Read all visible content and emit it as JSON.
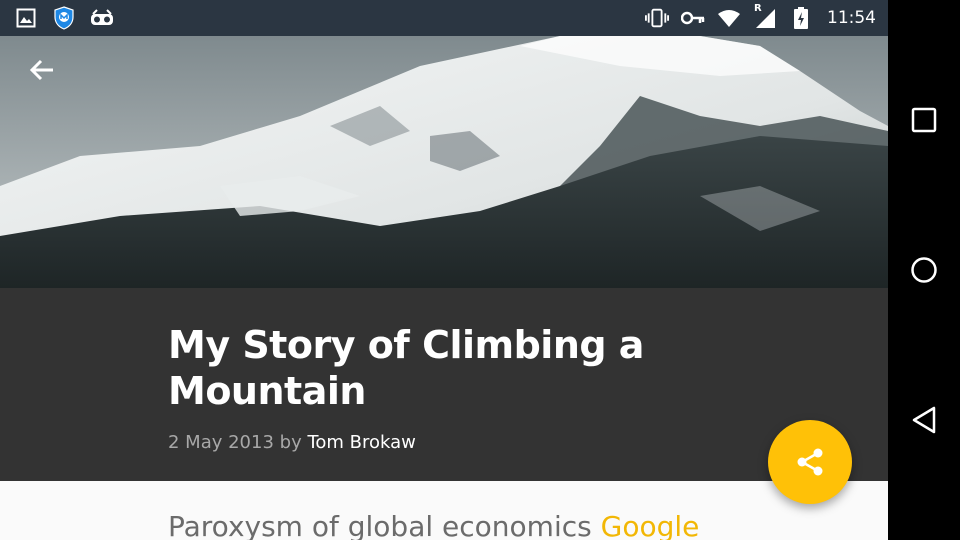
{
  "status_bar": {
    "left_icons": [
      "gallery-icon",
      "shield-app-icon",
      "glasses-icon"
    ],
    "right_icons": [
      "vibrate-icon",
      "vpn-key-icon",
      "wifi-icon",
      "cell-signal-icon",
      "battery-charging-icon"
    ],
    "roaming_indicator": "R",
    "time": "11:54",
    "background": "#2b3642"
  },
  "header": {
    "back_icon": "arrow-back-icon",
    "image": "snowy-mountain-landscape"
  },
  "article": {
    "title": "My Story of Climbing a Mountain",
    "date": "2 May 2013",
    "by": "by",
    "author": "Tom Brokaw",
    "body_text": "Paroxysm of global economics",
    "body_highlight": "Google"
  },
  "fab": {
    "icon": "share-icon",
    "color": "#ffc107"
  },
  "nav_bar": {
    "icons": [
      "recents-icon",
      "home-icon",
      "back-icon"
    ]
  },
  "colors": {
    "title_panel": "#333333",
    "accent": "#ffc107",
    "highlight_text": "#f2b705"
  }
}
